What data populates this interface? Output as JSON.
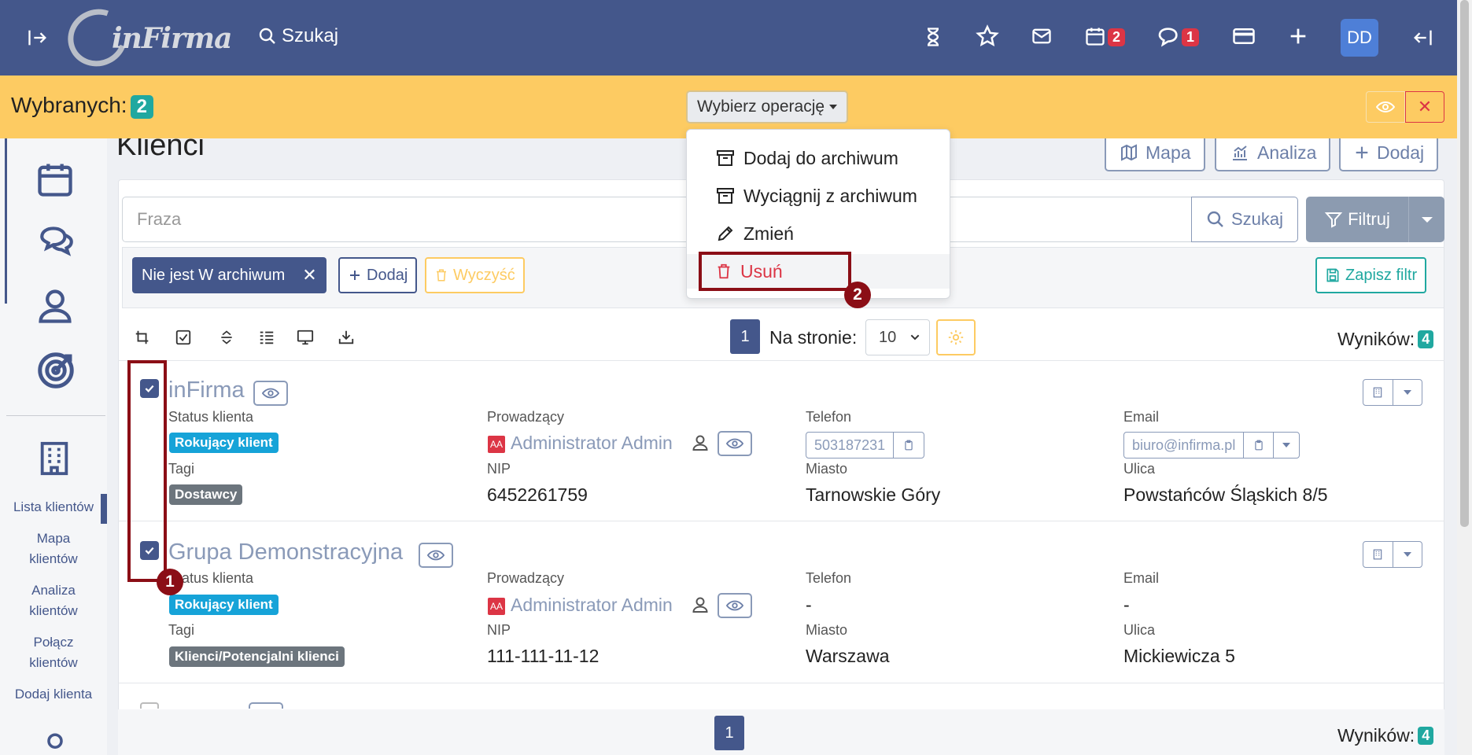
{
  "topbar": {
    "logo_text": "inFirma",
    "search_label": "Szukaj",
    "calendar_badge": "2",
    "chat_badge": "1",
    "user_initials": "DD"
  },
  "selection": {
    "label": "Wybranych:",
    "count": "2",
    "operation_button": "Wybierz operację"
  },
  "operation_menu": {
    "items": [
      {
        "label": "Dodaj do archiwum",
        "icon": "archive-icon"
      },
      {
        "label": "Wyciągnij z archiwum",
        "icon": "archive-icon"
      },
      {
        "label": "Zmień",
        "icon": "pencil-icon"
      },
      {
        "label": "Usuń",
        "icon": "trash-icon"
      }
    ]
  },
  "sidebar": {
    "links": [
      "Lista klientów",
      "Mapa klientów",
      "Analiza klientów",
      "Połącz klientów",
      "Dodaj klienta"
    ]
  },
  "page": {
    "title": "Klienci",
    "buttons": {
      "map": "Mapa",
      "analysis": "Analiza",
      "add": "Dodaj"
    }
  },
  "search": {
    "placeholder": "Fraza",
    "search_button": "Szukaj",
    "filter_button": "Filtruj"
  },
  "filters": {
    "active_chip": "Nie jest W archiwum",
    "add_button": "Dodaj",
    "clear_button": "Wyczyść",
    "save_button": "Zapisz filtr"
  },
  "pagination": {
    "current_page": "1",
    "per_page_label": "Na stronie:",
    "per_page_value": "10",
    "results_label": "Wyników:",
    "results_count": "4"
  },
  "field_labels": {
    "status": "Status klienta",
    "owner": "Prowadzący",
    "phone": "Telefon",
    "email": "Email",
    "tags": "Tagi",
    "nip": "NIP",
    "city": "Miasto",
    "street": "Ulica"
  },
  "clients": [
    {
      "name": "inFirma",
      "status": "Rokujący klient",
      "owner": "Administrator Admin",
      "owner_initials": "AA",
      "phone": "503187231",
      "email": "biuro@infirma.pl",
      "tag": "Dostawcy",
      "nip": "6452261759",
      "city": "Tarnowskie Góry",
      "street": "Powstańców Śląskich 8/5"
    },
    {
      "name": "Grupa Demonstracyjna",
      "status": "Rokujący klient",
      "owner": "Administrator Admin",
      "owner_initials": "AA",
      "phone": "-",
      "email": "-",
      "tag": "Klienci/Potencjalni klienci",
      "nip": "111-111-11-12",
      "city": "Warszawa",
      "street": "Mickiewicza 5"
    }
  ],
  "annotations": {
    "step1": "1",
    "step2": "2"
  },
  "colors": {
    "navy": "#44578b",
    "yellow": "#fdcb62",
    "teal": "#20a8a0",
    "danger": "#dc3545",
    "annotation": "#8b0e16",
    "status_blue": "#16a3d8"
  }
}
